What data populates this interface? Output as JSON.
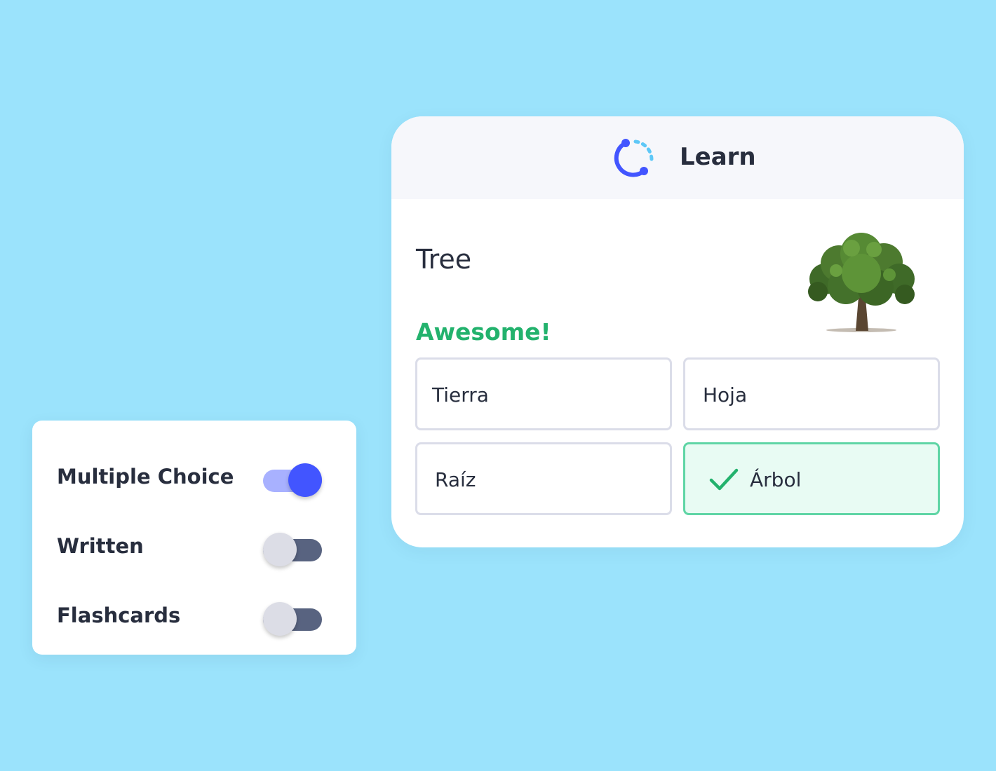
{
  "learn": {
    "title": "Learn",
    "logo_icon": "learn-mode-icon",
    "term": "Tree",
    "feedback": "Awesome!",
    "options": [
      {
        "label": "Tierra",
        "correct": false
      },
      {
        "label": "Hoja",
        "correct": false
      },
      {
        "label": "Raíz",
        "correct": false
      },
      {
        "label": "Árbol",
        "correct": true
      }
    ]
  },
  "settings": {
    "items": [
      {
        "label": "Multiple Choice",
        "enabled": true
      },
      {
        "label": "Written",
        "enabled": false
      },
      {
        "label": "Flashcards",
        "enabled": false
      }
    ]
  },
  "colors": {
    "background": "#9be3fc",
    "accent": "#4255ff",
    "success": "#23b26d",
    "success_border": "#5fd5a5",
    "success_fill": "#e8fbf3"
  }
}
